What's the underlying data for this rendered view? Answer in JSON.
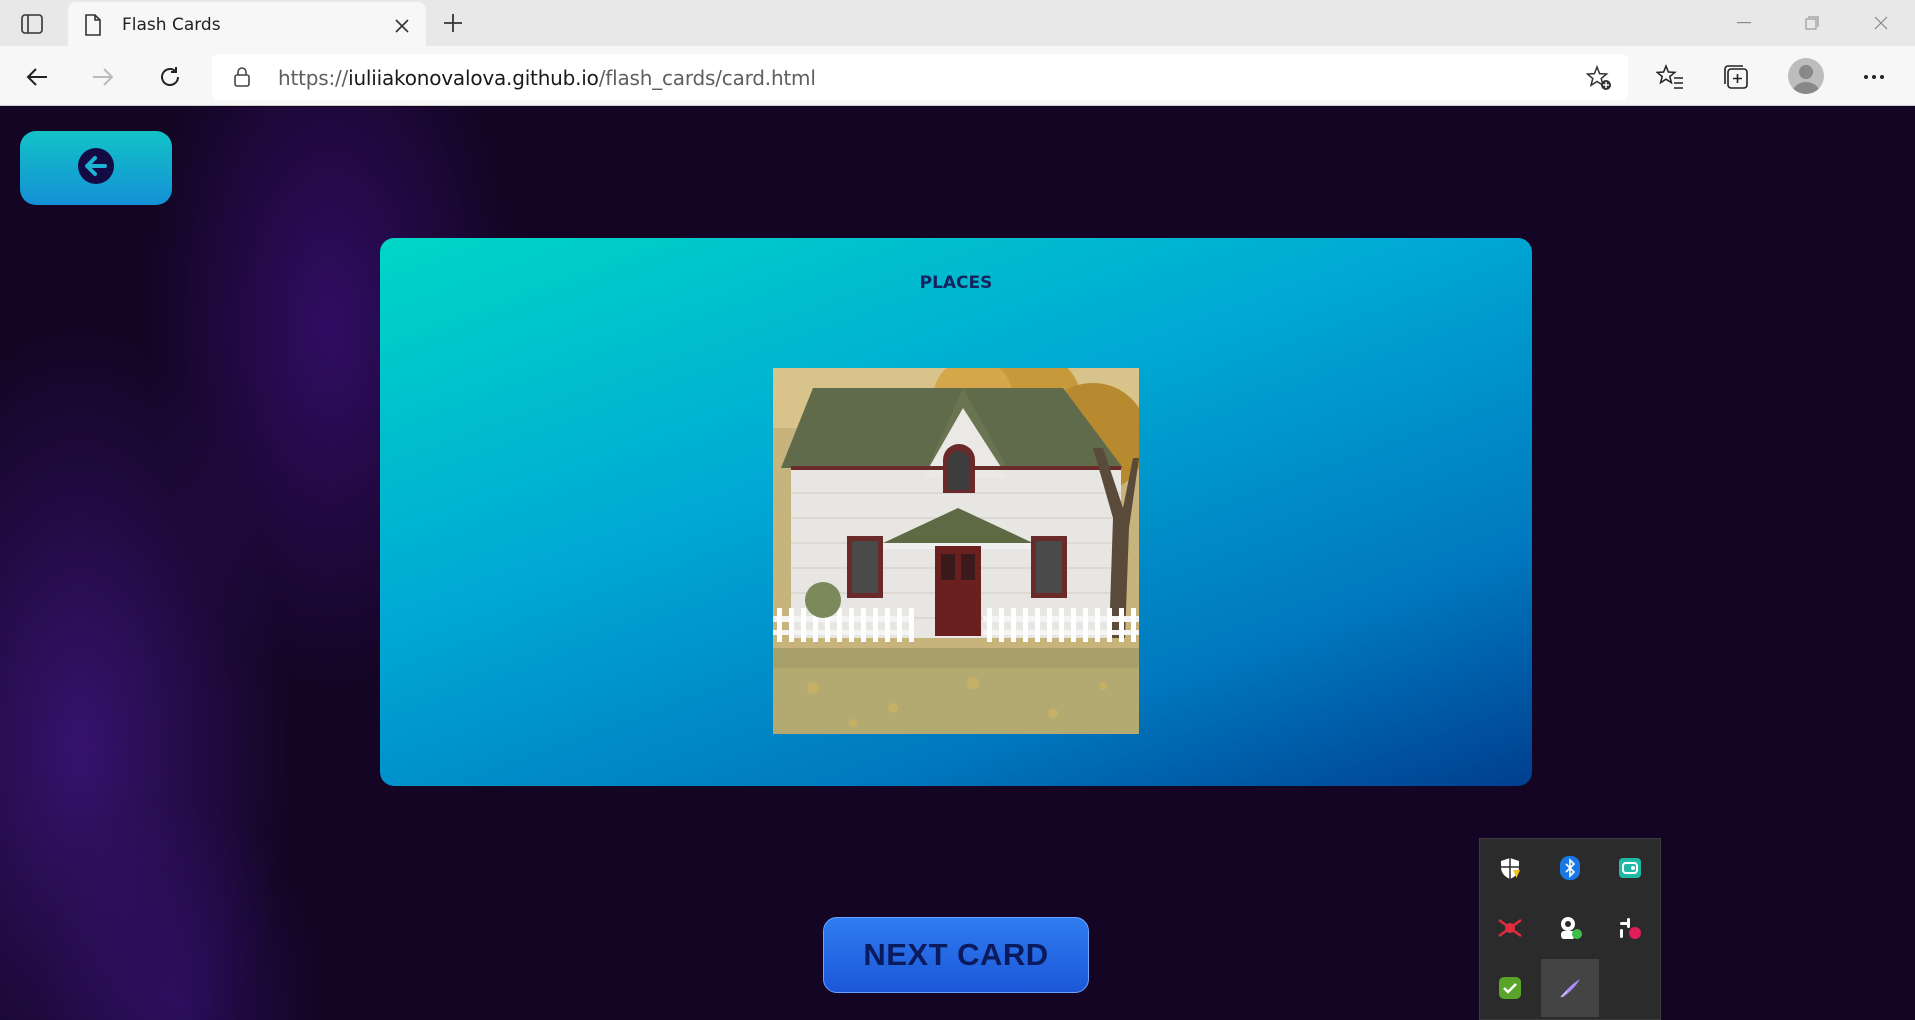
{
  "browser": {
    "tab_title": "Flash Cards",
    "url_prefix": "https://",
    "url_host": "iuliiakonovalova.github.io",
    "url_path": "/flash_cards/card.html"
  },
  "icons": {
    "tab_actions": "tab-actions-icon",
    "page": "page-icon",
    "close": "close-icon",
    "new_tab": "plus-icon",
    "back": "arrow-left-icon",
    "forward": "arrow-right-icon",
    "refresh": "refresh-icon",
    "lock": "lock-icon",
    "add_favorite": "star-plus-icon",
    "favorites": "favorites-icon",
    "collections": "collections-icon",
    "profile": "avatar",
    "menu": "more-icon"
  },
  "card": {
    "category": "PLACES",
    "image_subject": "house"
  },
  "buttons": {
    "next_card": "NEXT CARD"
  },
  "tray": {
    "items": [
      "windows-security-icon",
      "bluetooth-icon",
      "app-green-icon",
      "network-red-icon",
      "user-green-icon",
      "slack-icon",
      "shield-check-icon",
      "pen-icon"
    ]
  },
  "colors": {
    "card_gradient_start": "#00d6c6",
    "card_gradient_end": "#003f8f",
    "page_background": "#140524",
    "next_button": "#1b57d8",
    "back_button": "#12c3c7"
  }
}
